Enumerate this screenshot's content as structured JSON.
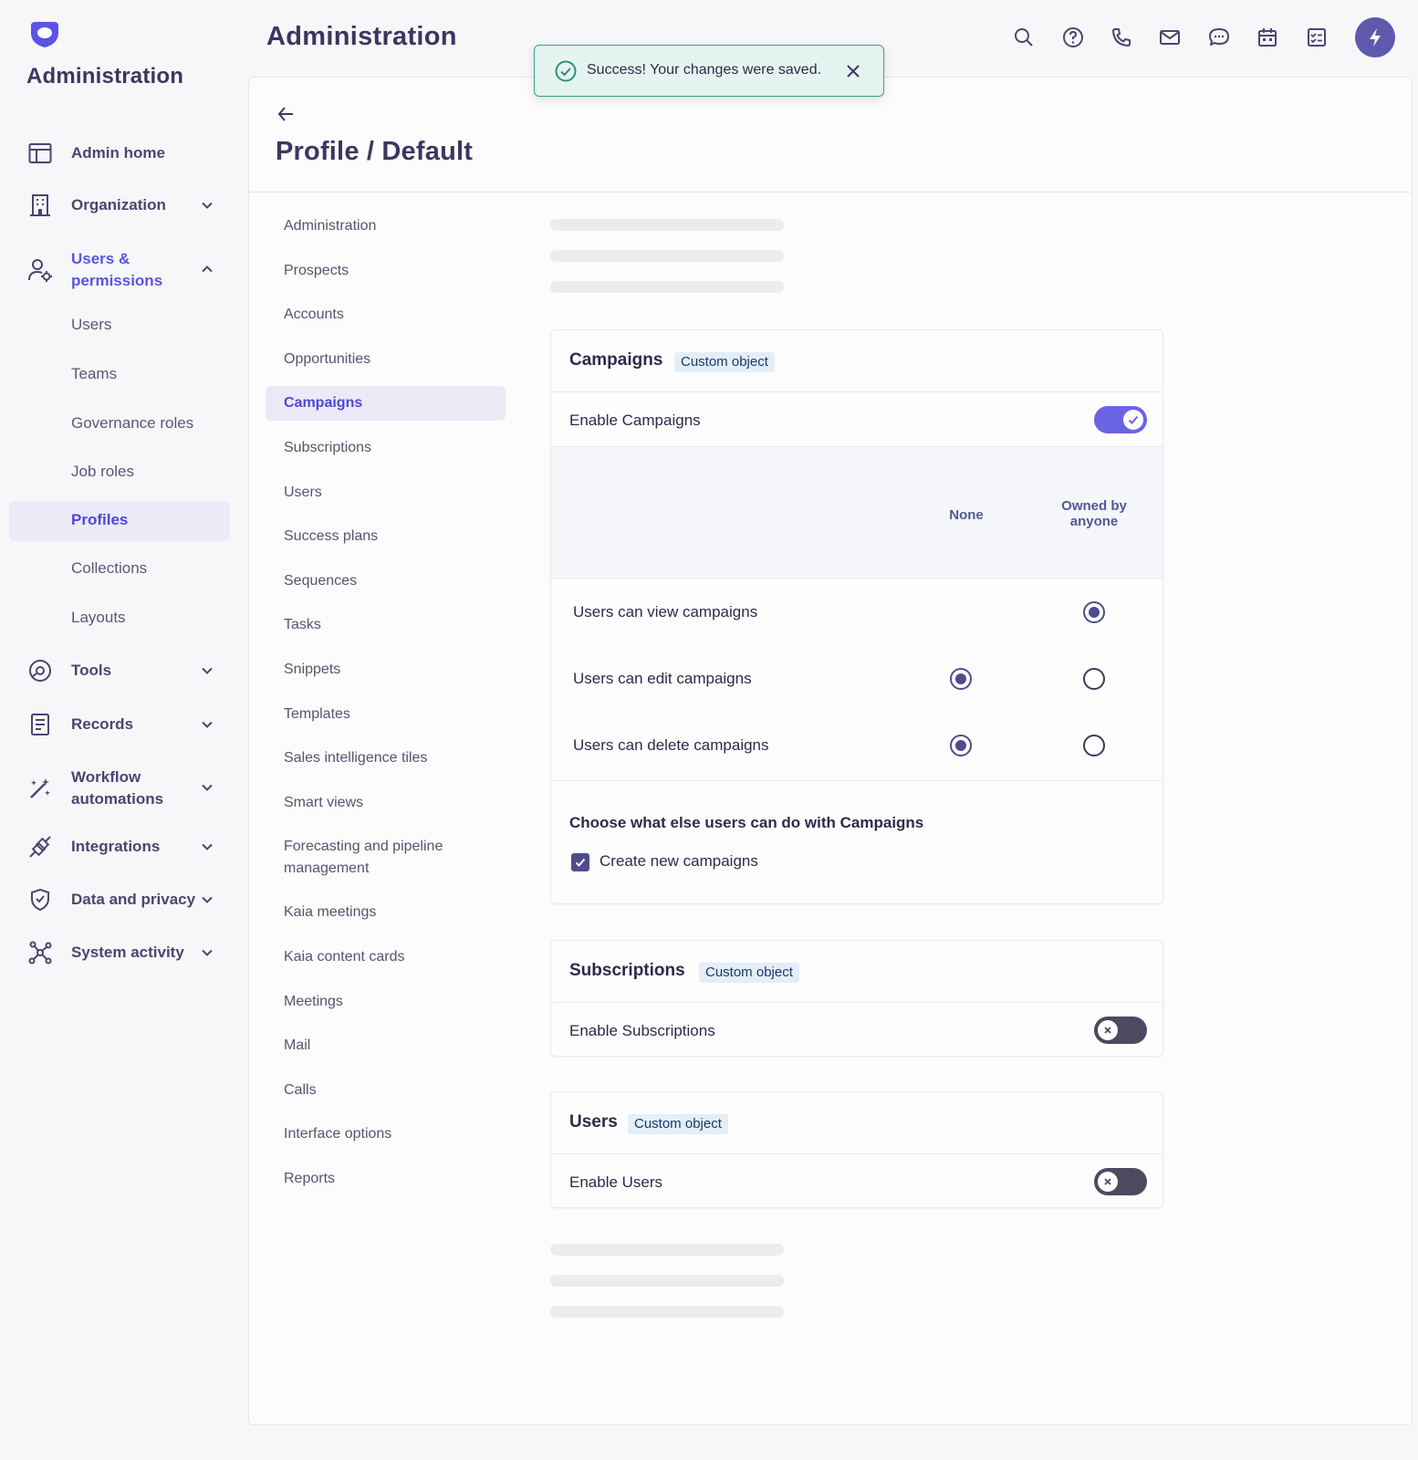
{
  "app": {
    "title": "Administration",
    "header_title": "Administration"
  },
  "sidebar": {
    "items": [
      {
        "label": "Admin home",
        "icon": "layout-icon"
      },
      {
        "label": "Organization",
        "icon": "building-icon"
      },
      {
        "label": "Users & permissions",
        "icon": "user-gear-icon"
      },
      {
        "label": "Tools",
        "icon": "tools-icon"
      },
      {
        "label": "Records",
        "icon": "records-icon"
      },
      {
        "label": "Workflow automations",
        "icon": "wand-icon"
      },
      {
        "label": "Integrations",
        "icon": "plug-icon"
      },
      {
        "label": "Data and privacy",
        "icon": "shield-icon"
      },
      {
        "label": "System activity",
        "icon": "network-icon"
      }
    ],
    "users_permissions_sub": [
      "Users",
      "Teams",
      "Governance roles",
      "Job roles",
      "Profiles",
      "Collections",
      "Layouts"
    ],
    "selected_sub": "Profiles"
  },
  "toast": {
    "message": "Success! Your changes were saved."
  },
  "page": {
    "title": "Profile / Default"
  },
  "section_nav": {
    "items": [
      "Administration",
      "Prospects",
      "Accounts",
      "Opportunities",
      "Campaigns",
      "Subscriptions",
      "Users",
      "Success plans",
      "Sequences",
      "Tasks",
      "Snippets",
      "Templates",
      "Sales intelligence tiles",
      "Smart views",
      "Forecasting and pipeline management",
      "Kaia meetings",
      "Kaia content cards",
      "Meetings",
      "Mail",
      "Calls",
      "Interface options",
      "Reports"
    ],
    "selected": "Campaigns"
  },
  "campaigns": {
    "title": "Campaigns",
    "badge": "Custom object",
    "enable_label": "Enable Campaigns",
    "enabled": true,
    "columns": [
      "None",
      "Owned by anyone"
    ],
    "permissions": [
      {
        "label": "Users can view campaigns",
        "selected": "Owned by anyone"
      },
      {
        "label": "Users can edit campaigns",
        "selected": "None"
      },
      {
        "label": "Users can delete campaigns",
        "selected": "None"
      }
    ],
    "else_title": "Choose what else users can do with Campaigns",
    "checkbox_label": "Create new campaigns",
    "checkbox_checked": true
  },
  "subscriptions": {
    "title": "Subscriptions",
    "badge": "Custom object",
    "enable_label": "Enable Subscriptions",
    "enabled": false
  },
  "users_card": {
    "title": "Users",
    "badge": "Custom object",
    "enable_label": "Enable Users",
    "enabled": false
  },
  "colors": {
    "accent": "#5b53e6",
    "toggle_on": "#6b63e6",
    "toast_border": "#3f9e86"
  }
}
